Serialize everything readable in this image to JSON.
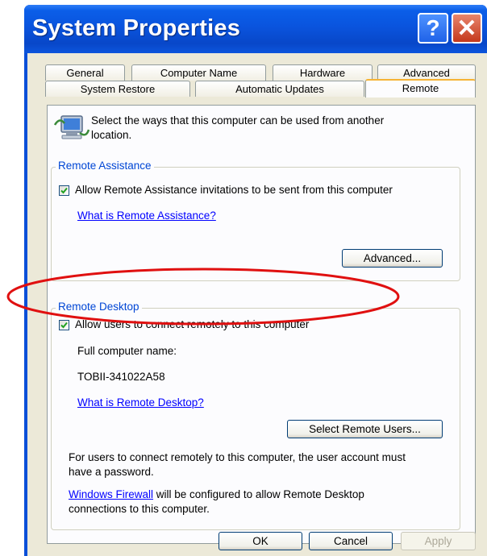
{
  "window": {
    "title": "System Properties",
    "help_glyph": "?",
    "close_glyph": "✕"
  },
  "tabs": {
    "row1": [
      "General",
      "Computer Name",
      "Hardware",
      "Advanced"
    ],
    "row2": [
      "System Restore",
      "Automatic Updates",
      "Remote"
    ],
    "active": "Remote"
  },
  "intro": {
    "icon": "remote-computer-icon",
    "text_line1": "Select the ways that this computer can be used from another",
    "text_line2": "location."
  },
  "remote_assistance": {
    "title": "Remote Assistance",
    "checkbox_label": "Allow Remote Assistance invitations to be sent from this computer",
    "checked": true,
    "help_link": "What is Remote Assistance?",
    "advanced_button": "Advanced..."
  },
  "remote_desktop": {
    "title": "Remote Desktop",
    "checkbox_label": "Allow users to connect remotely to this computer",
    "checked": true,
    "computer_name_label": "Full computer name:",
    "computer_name_value": "TOBII-341022A58",
    "help_link": "What is Remote Desktop?",
    "select_users_button": "Select Remote Users...",
    "password_note_line1": "For users to connect remotely to this computer, the user account must",
    "password_note_line2": "have a password.",
    "firewall_link": "Windows Firewall",
    "firewall_note_rest": " will be configured to allow Remote Desktop",
    "firewall_note_line2": "connections to this computer."
  },
  "footer": {
    "ok": "OK",
    "cancel": "Cancel",
    "apply": "Apply"
  },
  "colors": {
    "annotation_ellipse": "#e01010",
    "group_title": "#0046d5",
    "link": "#0000ff"
  }
}
